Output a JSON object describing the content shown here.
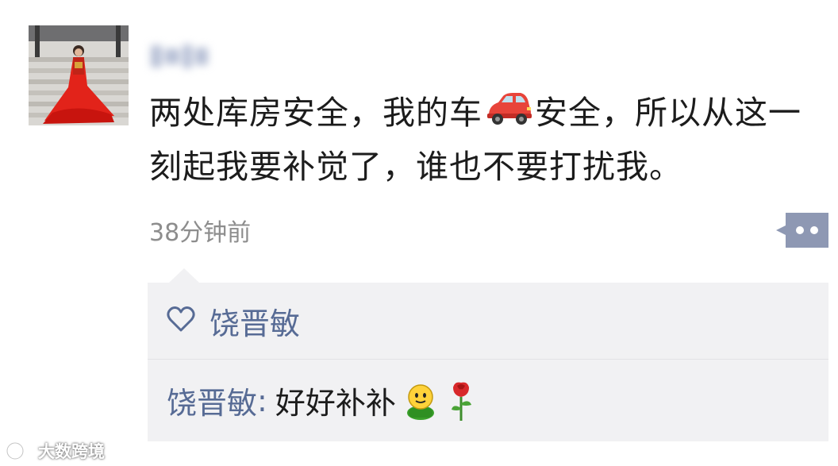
{
  "post": {
    "username_redacted": true,
    "text_part1": "两处库房安全，我的车",
    "car_emoji": "car-emoji",
    "text_part2": "安全，所以从这一刻起我要补觉了，谁也不要打扰我。",
    "timestamp": "38分钟前",
    "more_icon": "more-dots-icon"
  },
  "likes": {
    "icon": "heart-icon",
    "names": "饶晋敏"
  },
  "comments": [
    {
      "author": "饶晋敏",
      "separator": ":",
      "text": "好好补补",
      "emoji": [
        "smiley-emoji",
        "rose-emoji"
      ]
    }
  ],
  "watermark": {
    "text": "大数跨境",
    "logo": "watermark-logo"
  },
  "colors": {
    "link_blue": "#576b95",
    "comment_bg": "#f1f1f3",
    "more_button": "#8e98b3"
  }
}
